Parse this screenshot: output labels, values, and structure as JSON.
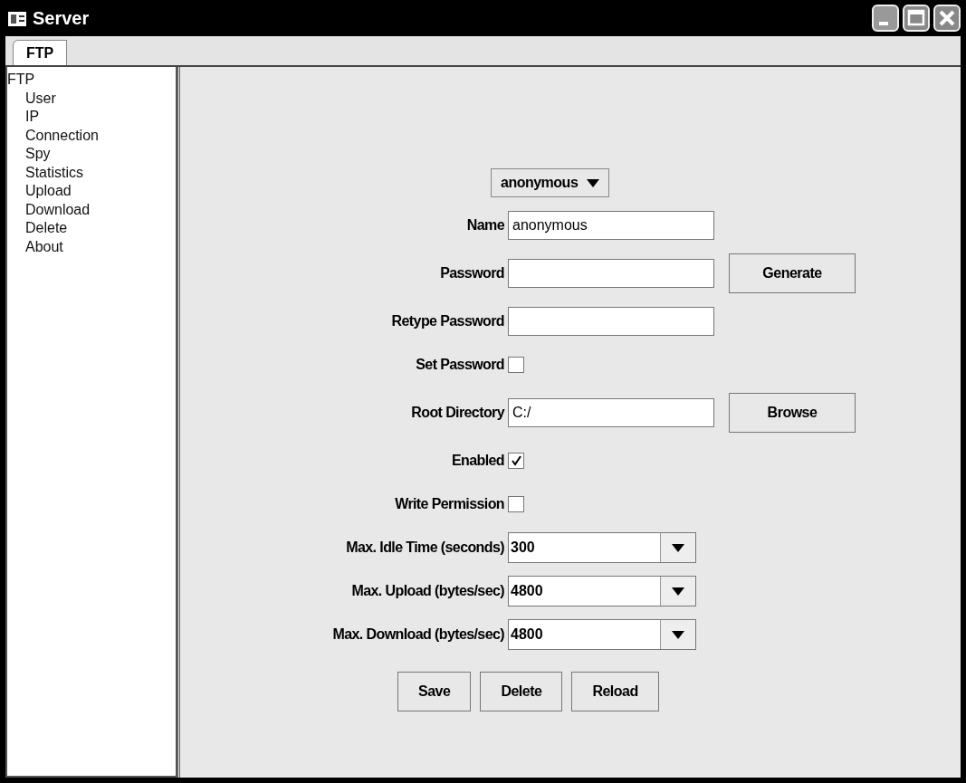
{
  "window": {
    "title": "Server"
  },
  "tabs": [
    {
      "label": "FTP",
      "selected": true
    }
  ],
  "tree": {
    "label": "FTP",
    "children": [
      {
        "label": "User"
      },
      {
        "label": "IP"
      },
      {
        "label": "Connection"
      },
      {
        "label": "Spy"
      },
      {
        "label": "Statistics"
      },
      {
        "label": "Upload"
      },
      {
        "label": "Download"
      },
      {
        "label": "Delete"
      },
      {
        "label": "About"
      }
    ]
  },
  "user_select": {
    "value": "anonymous"
  },
  "fields": [
    {
      "kind": "text",
      "label": "Name",
      "value": "anonymous"
    },
    {
      "kind": "text",
      "label": "Password",
      "button": "Generate"
    },
    {
      "kind": "text",
      "label": "Retype Password"
    },
    {
      "kind": "checkbox",
      "label": "Set Password",
      "checked": false
    },
    {
      "kind": "text",
      "label": "Root Directory",
      "value": "C:/",
      "button": "Browse"
    },
    {
      "kind": "checkbox",
      "label": "Enabled",
      "checked": true
    },
    {
      "kind": "checkbox",
      "label": "Write Permission",
      "checked": false
    },
    {
      "kind": "select",
      "label": "Max. Idle Time (seconds)",
      "value": "300"
    },
    {
      "kind": "select",
      "label": "Max. Upload (bytes/sec)",
      "value": "4800"
    },
    {
      "kind": "select",
      "label": "Max. Download (bytes/sec)",
      "value": "4800"
    }
  ],
  "buttons": [
    "Save",
    "Delete",
    "Reload"
  ]
}
